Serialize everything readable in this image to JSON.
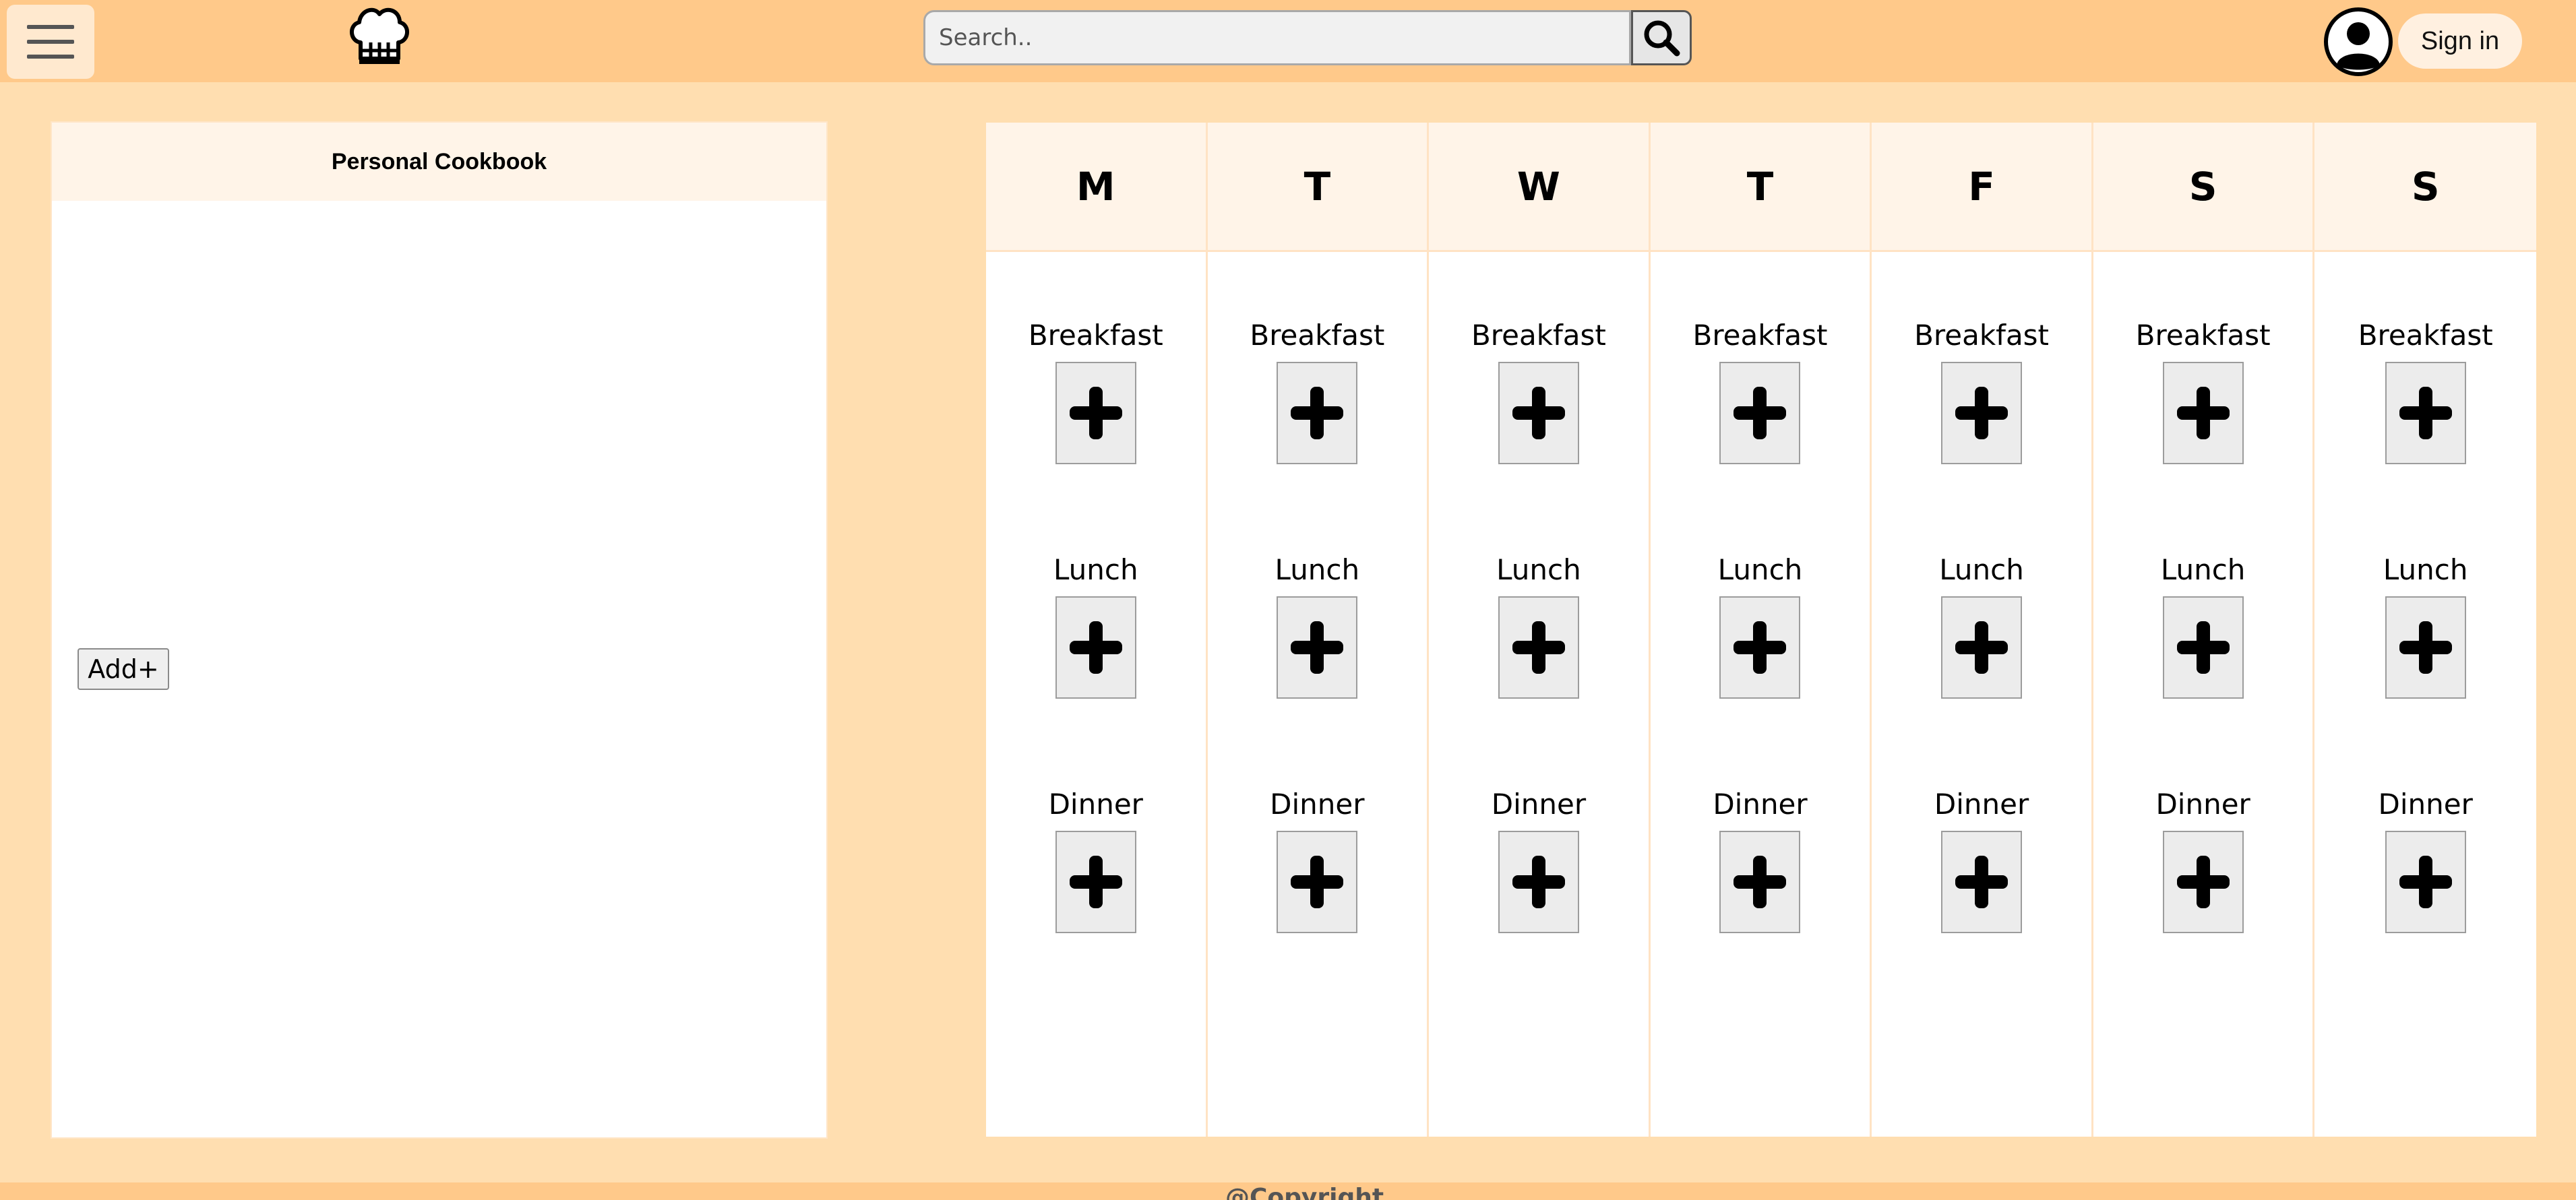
{
  "colors": {
    "page_background": "#ffdeb0",
    "header_background": "#ffc98a",
    "panel_header_background": "#fff4e8",
    "signin_background": "#fff0e0",
    "meal_button_background": "#ececec"
  },
  "header": {
    "menu_icon": "hamburger-menu-icon",
    "logo_icon": "chef-hat-icon",
    "search": {
      "placeholder": "Search..",
      "value": "",
      "icon": "magnifier-icon"
    },
    "account_icon": "user-account-icon",
    "signin_label": "Sign in"
  },
  "cookbook": {
    "title": "Personal Cookbook",
    "add_label": "Add+"
  },
  "planner": {
    "days": [
      {
        "label": "M",
        "meals": [
          "Breakfast",
          "Lunch",
          "Dinner"
        ]
      },
      {
        "label": "T",
        "meals": [
          "Breakfast",
          "Lunch",
          "Dinner"
        ]
      },
      {
        "label": "W",
        "meals": [
          "Breakfast",
          "Lunch",
          "Dinner"
        ]
      },
      {
        "label": "T",
        "meals": [
          "Breakfast",
          "Lunch",
          "Dinner"
        ]
      },
      {
        "label": "F",
        "meals": [
          "Breakfast",
          "Lunch",
          "Dinner"
        ]
      },
      {
        "label": "S",
        "meals": [
          "Breakfast",
          "Lunch",
          "Dinner"
        ]
      },
      {
        "label": "S",
        "meals": [
          "Breakfast",
          "Lunch",
          "Dinner"
        ]
      }
    ],
    "add_meal_icon": "plus-icon"
  },
  "footer": {
    "text": "@Copyright"
  }
}
